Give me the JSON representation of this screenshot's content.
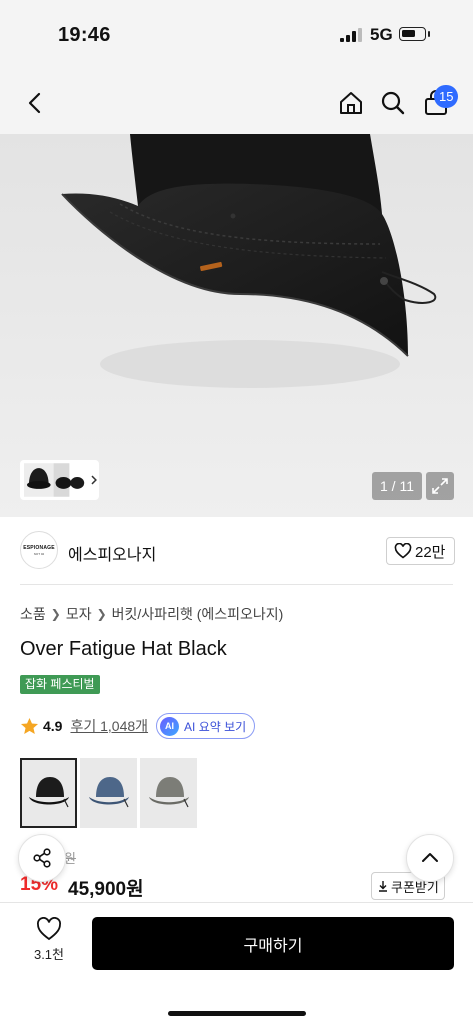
{
  "status_bar": {
    "time": "19:46",
    "network": "5G"
  },
  "nav": {
    "back_icon": "chevron-left-icon",
    "home_icon": "home-icon",
    "search_icon": "search-icon",
    "cart_icon": "shopping-bag-icon",
    "cart_count": "15"
  },
  "gallery": {
    "counter": "1 / 11",
    "expand_icon": "expand-icon"
  },
  "brand": {
    "logo_text": "ESPIONAGE",
    "logo_sub": "NOT 02",
    "name": "에스피오나지",
    "like_count": "22만"
  },
  "breadcrumb": [
    "소품",
    "모자",
    "버킷/사파리햇 (에스피오나지)"
  ],
  "product": {
    "title": "Over Fatigue Hat Black",
    "festival_tag": "잡화 페스티벌",
    "rating": "4.9",
    "reviews": "후기 1,048개",
    "ai_badge": "AI",
    "ai_label": "AI 요약 보기"
  },
  "options": [
    {
      "name": "black",
      "color": "#1c1c1c"
    },
    {
      "name": "navy",
      "color": "#4d6789"
    },
    {
      "name": "gray",
      "color": "#7c7d77"
    }
  ],
  "pricing": {
    "original_suffix": "원",
    "discount": "15%",
    "price": "45,900원",
    "coupon_label": "쿠폰받기"
  },
  "bottom_bar": {
    "wish_count": "3.1천",
    "buy_label": "구매하기"
  },
  "colors": {
    "accent_blue": "#2f6bff",
    "festival_green": "#3f9a55",
    "discount_red": "#ef2b2b"
  }
}
